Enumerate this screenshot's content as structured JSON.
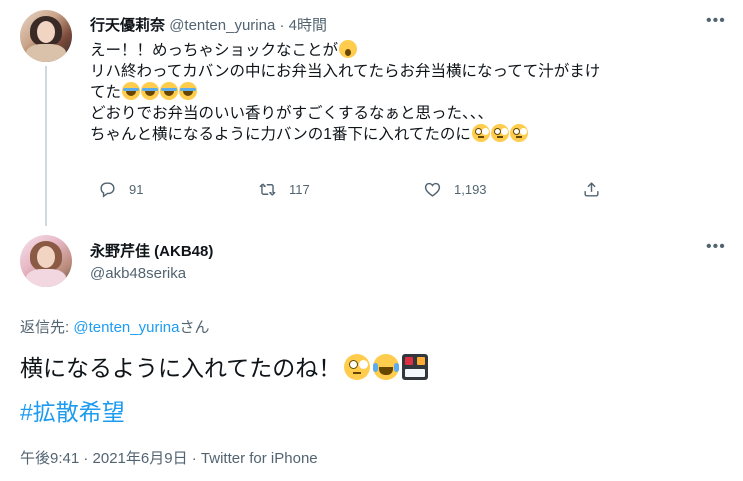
{
  "parent": {
    "display_name": "行天優莉奈",
    "handle": "@tenten_yurina",
    "separator": "·",
    "time": "4時間",
    "text_lines": [
      "えー！！めっちゃショックなことが",
      "リハ終わってカバンの中にお弁当入れてたらお弁当横になってて汁がまけ",
      "てた",
      "どおりでお弁当のいい香りがすごくするなぁと思った、、、",
      "ちゃんと横になるように力バンの1番下に入れてたのに"
    ],
    "emoji": {
      "line1": [
        "scream"
      ],
      "line3": [
        "sob",
        "sob",
        "sob",
        "sob"
      ],
      "line5": [
        "face-with-rolling-eyes",
        "face-with-rolling-eyes",
        "face-with-rolling-eyes"
      ]
    },
    "actions": {
      "reply_count": "91",
      "retweet_count": "117",
      "like_count": "1,193"
    }
  },
  "reply": {
    "display_name": "永野芹佳 (AKB48)",
    "handle": "@akb48serika",
    "reply_to_prefix": "返信先: ",
    "reply_to_handle": "@tenten_yurina",
    "reply_to_suffix": "さん",
    "text": "横になるように入れてたのね！",
    "emoji": [
      "face-with-rolling-eyes",
      "face-with-tears-of-joy",
      "bento-box"
    ],
    "hashtag": "#拡散希望",
    "timestamp": "午後9:41 · 2021年6月9日 · Twitter for iPhone"
  },
  "colors": {
    "text": "#0f1419",
    "secondary": "#536471",
    "link": "#1d9bf0",
    "thread_line": "#cfd9de"
  }
}
